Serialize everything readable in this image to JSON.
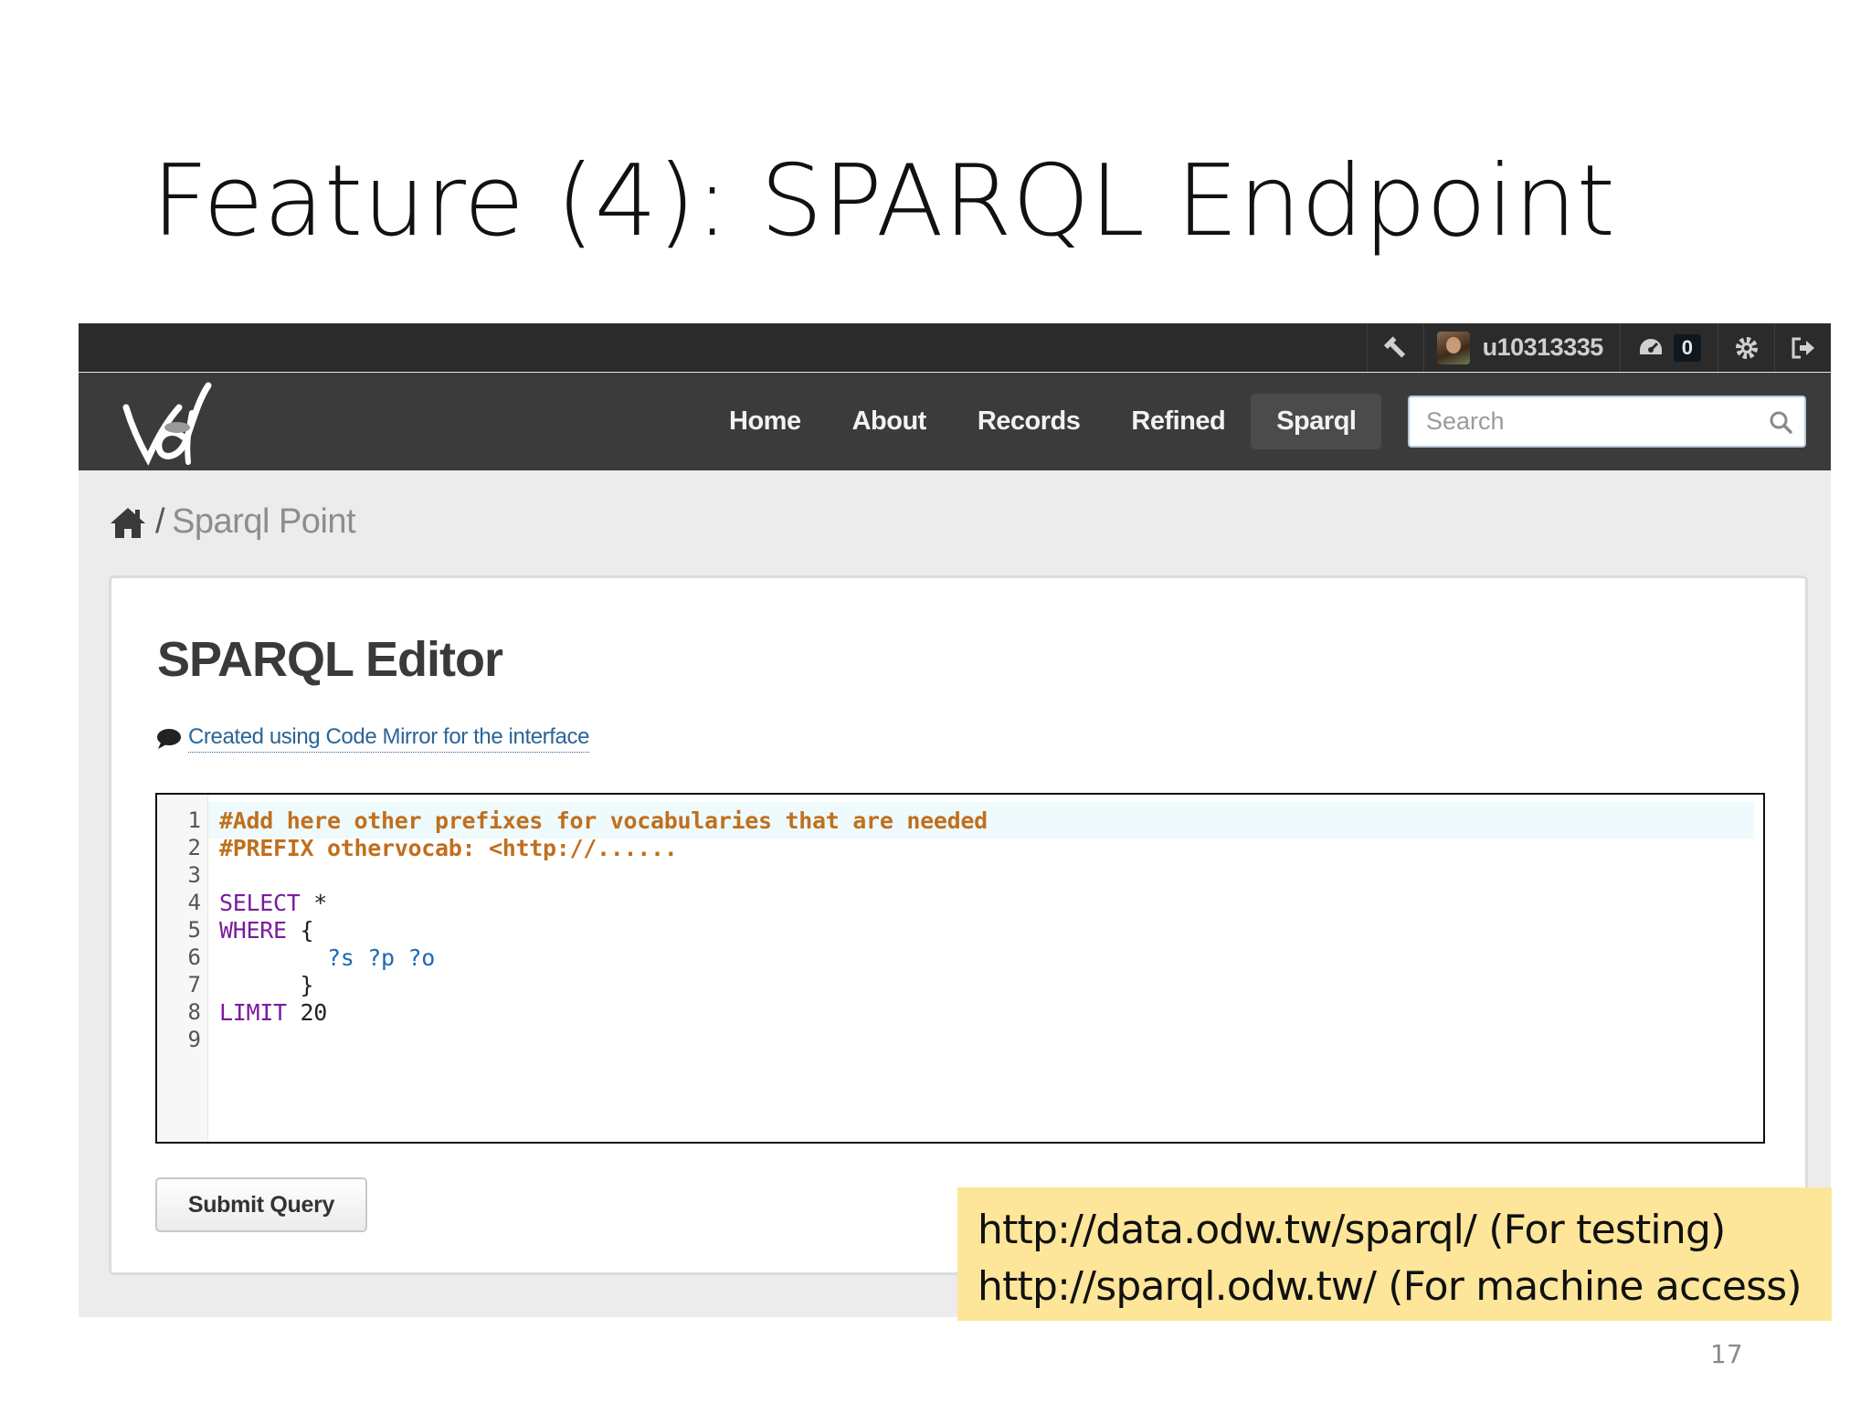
{
  "slide": {
    "title": "Feature (4): SPARQL Endpoint",
    "page_number": "17",
    "callout": {
      "line1": "http://data.odw.tw/sparql/ (For testing)",
      "line2": "http://sparql.odw.tw/ (For machine access)"
    }
  },
  "topbar": {
    "icons": [
      "hammer-icon",
      "dashboard-icon",
      "gear-icon",
      "sign-out-icon"
    ],
    "username": "u10313335",
    "notification_count": "0"
  },
  "navbar": {
    "links": [
      {
        "label": "Home",
        "active": false
      },
      {
        "label": "About",
        "active": false
      },
      {
        "label": "Records",
        "active": false
      },
      {
        "label": "Refined",
        "active": false
      },
      {
        "label": "Sparql",
        "active": true
      }
    ],
    "search_placeholder": "Search"
  },
  "breadcrumb": {
    "separator": "/",
    "current": "Sparql Point"
  },
  "panel": {
    "title": "SPARQL Editor",
    "note_link": "Created using Code Mirror for the interface",
    "submit_label": "Submit Query"
  },
  "editor": {
    "lines": [
      {
        "num": "1",
        "text": "#Add here other prefixes for vocabularies that are needed"
      },
      {
        "num": "2",
        "text": "#PREFIX othervocab: <http://......"
      },
      {
        "num": "3",
        "text": ""
      },
      {
        "num": "4",
        "kw": "SELECT",
        "rest": " *"
      },
      {
        "num": "5",
        "kw": "WHERE",
        "rest": " {"
      },
      {
        "num": "6",
        "text": "        ?s ?p ?o"
      },
      {
        "num": "7",
        "text": "      }"
      },
      {
        "num": "8",
        "kw": "LIMIT",
        "rest": " 20"
      },
      {
        "num": "9",
        "text": ""
      }
    ]
  },
  "colors": {
    "topbar": "#2b2b2b",
    "navbar": "#3b3b3b",
    "comment": "#c06f1e",
    "keyword": "#7a1aa0",
    "variable": "#1d69b5",
    "callout": "#fde699"
  }
}
